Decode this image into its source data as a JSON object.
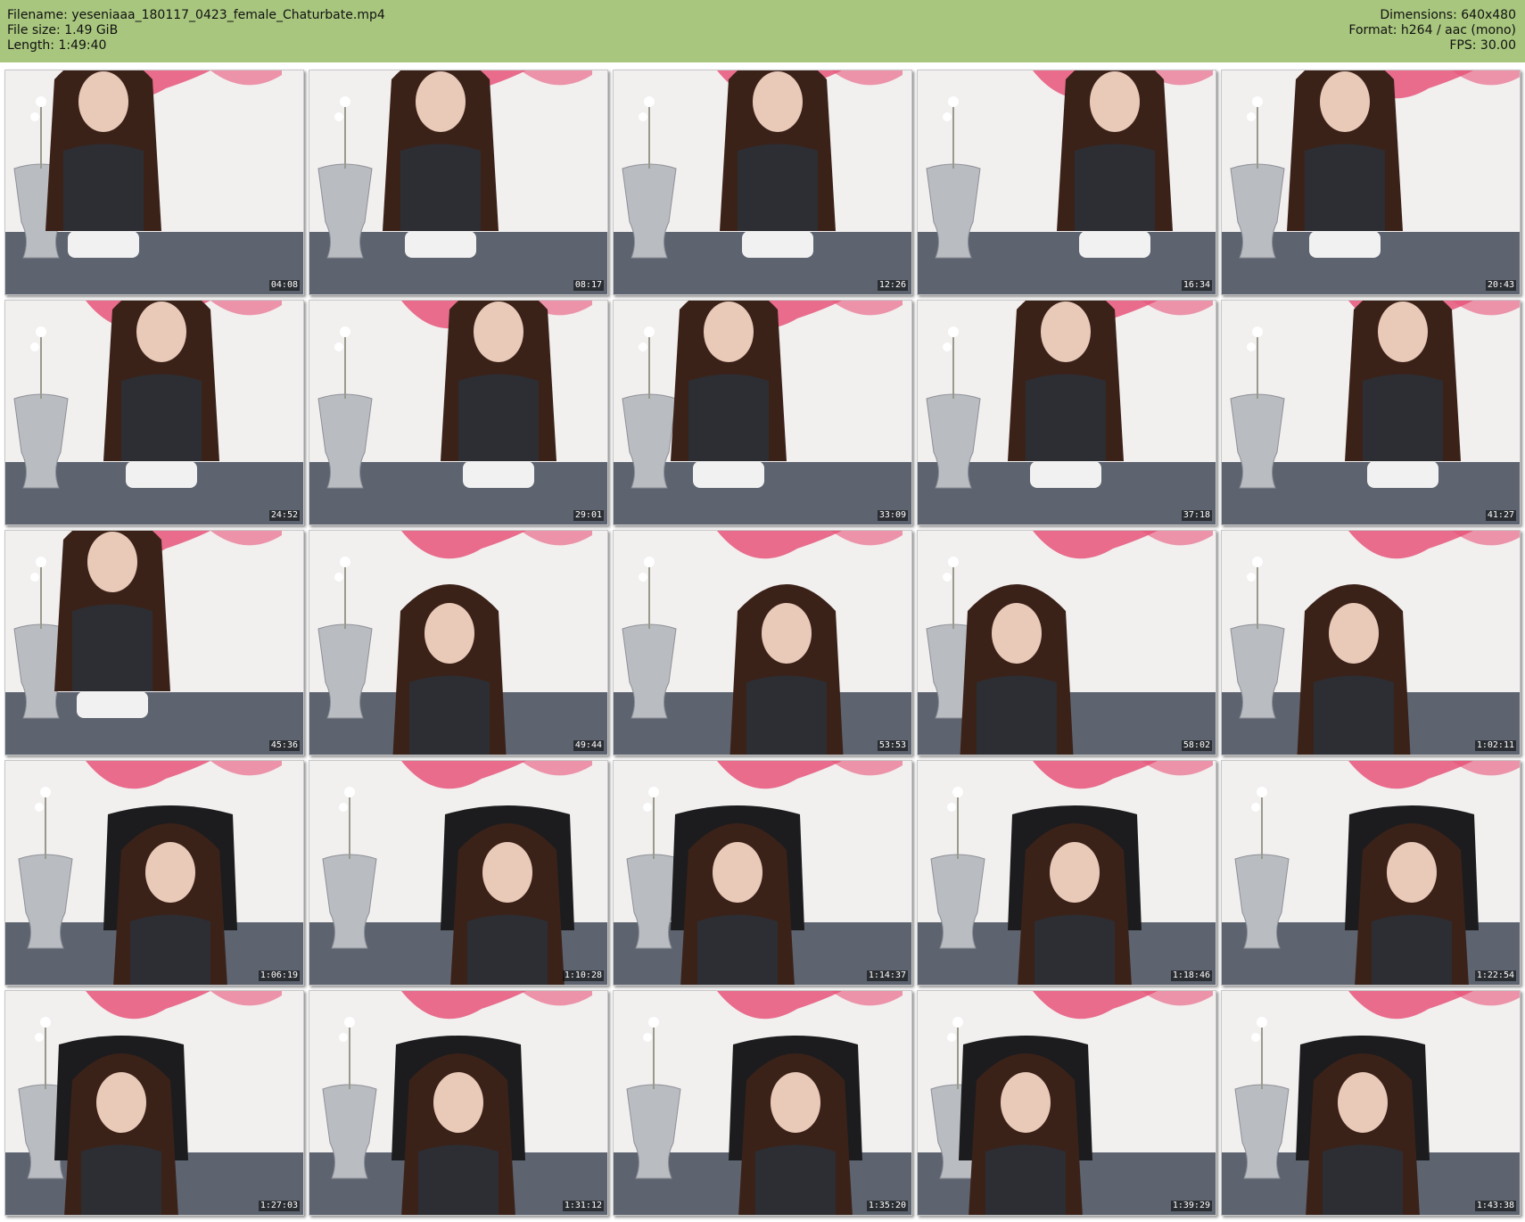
{
  "header": {
    "filename_label": "Filename:",
    "filename": "yeseniaaa_180117_0423_female_Chaturbate.mp4",
    "filesize_label": "File size:",
    "filesize": "1.49 GiB",
    "length_label": "Length:",
    "length": "1:49:40",
    "dimensions_label": "Dimensions:",
    "dimensions": "640x480",
    "format_label": "Format:",
    "format": "h264 / aac (mono)",
    "fps_label": "FPS:",
    "fps": "30.00"
  },
  "thumbnails": [
    {
      "time": "04:08"
    },
    {
      "time": "08:17"
    },
    {
      "time": "12:26"
    },
    {
      "time": "16:34"
    },
    {
      "time": "20:43"
    },
    {
      "time": "24:52"
    },
    {
      "time": "29:01"
    },
    {
      "time": "33:09"
    },
    {
      "time": "37:18"
    },
    {
      "time": "41:27"
    },
    {
      "time": "45:36"
    },
    {
      "time": "49:44"
    },
    {
      "time": "53:53"
    },
    {
      "time": "58:02"
    },
    {
      "time": "1:02:11"
    },
    {
      "time": "1:06:19"
    },
    {
      "time": "1:10:28"
    },
    {
      "time": "1:14:37"
    },
    {
      "time": "1:18:46"
    },
    {
      "time": "1:22:54"
    },
    {
      "time": "1:27:03"
    },
    {
      "time": "1:31:12"
    },
    {
      "time": "1:35:20"
    },
    {
      "time": "1:39:29"
    },
    {
      "time": "1:43:38"
    }
  ],
  "colors": {
    "header_bg": "#a8c67e",
    "wall": "#f2efef",
    "wall_art_pink": "#e8557a",
    "floor": "#5d6470",
    "vase_silver": "#b9bcc1",
    "hair": "#3b2219",
    "top_dark": "#2c2e33",
    "skin": "#e9c9b8",
    "chair_black": "#1c1c1e"
  }
}
